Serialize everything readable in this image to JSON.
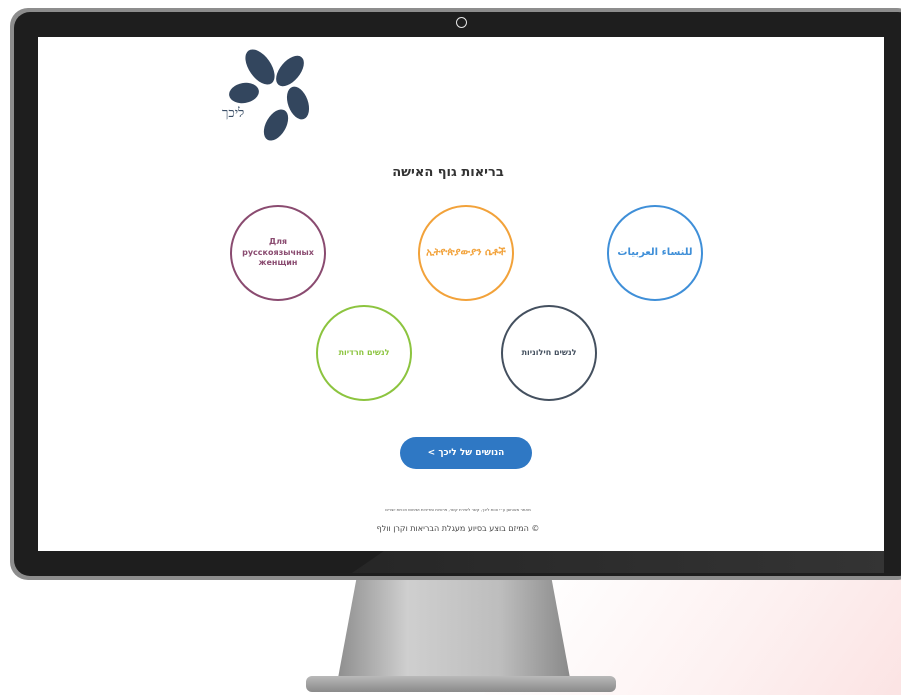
{
  "camera": {
    "icon": "webcam-icon"
  },
  "site": {
    "logo_text": "ליכך",
    "page_title": "בריאות גוף האישה",
    "circles": [
      {
        "label": "Для русскоязычных женщин",
        "color": "#8a4b70"
      },
      {
        "label": "ኢትዮጵያውያን ሴቶች",
        "color": "#f2a23a"
      },
      {
        "label": "للنساء العربيات",
        "color": "#3f8fd8"
      },
      {
        "label": "לנשים חרדיות",
        "color": "#8cc43f"
      },
      {
        "label": "לנשים חילוניות",
        "color": "#44505f"
      }
    ],
    "cta_label": "הנושים של ליכך >",
    "fine_print": "מאתר מאוחסן ע״י צוות ליכך, קשר ליצירת קשר, פרטיות ומדיניות ושימוש וזכויות יוצרים",
    "copyright": "© המיזם בוצע בסיוע מעגלת הבריאות וקרן וולף"
  },
  "colors": {
    "brand_blue": "#2f78c4",
    "logo_navy": "#33465e",
    "bezel": "#1e1e1e",
    "frame": "#8d8d8d"
  }
}
